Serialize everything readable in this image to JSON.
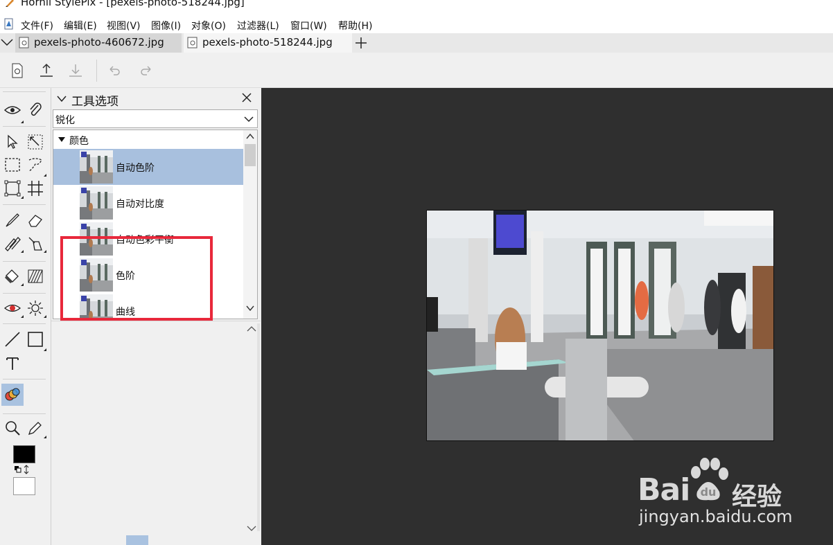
{
  "window": {
    "title": "Hornil StylePix - [pexels-photo-518244.jpg]"
  },
  "menu": [
    {
      "label": "文件(F)"
    },
    {
      "label": "编辑(E)"
    },
    {
      "label": "视图(V)"
    },
    {
      "label": "图像(I)"
    },
    {
      "label": "对象(O)"
    },
    {
      "label": "过滤器(L)"
    },
    {
      "label": "窗口(W)"
    },
    {
      "label": "帮助(H)"
    }
  ],
  "tabs": [
    {
      "label": "pexels-photo-460672.jpg"
    },
    {
      "label": "pexels-photo-518244.jpg"
    }
  ],
  "panel": {
    "title": "工具选项",
    "filter_value": "锐化",
    "category": "颜色",
    "items": [
      {
        "label": "自动色阶"
      },
      {
        "label": "自动对比度"
      },
      {
        "label": "自动色彩平衡"
      },
      {
        "label": "色阶"
      },
      {
        "label": "曲线"
      }
    ]
  },
  "colors": {
    "highlight": "#e8283b",
    "selection": "#a8c0de",
    "canvas_bg": "#2f2f2f"
  },
  "watermark": {
    "logo": "Bai",
    "logo_suffix": "经验",
    "url": "jingyan.baidu.com"
  }
}
